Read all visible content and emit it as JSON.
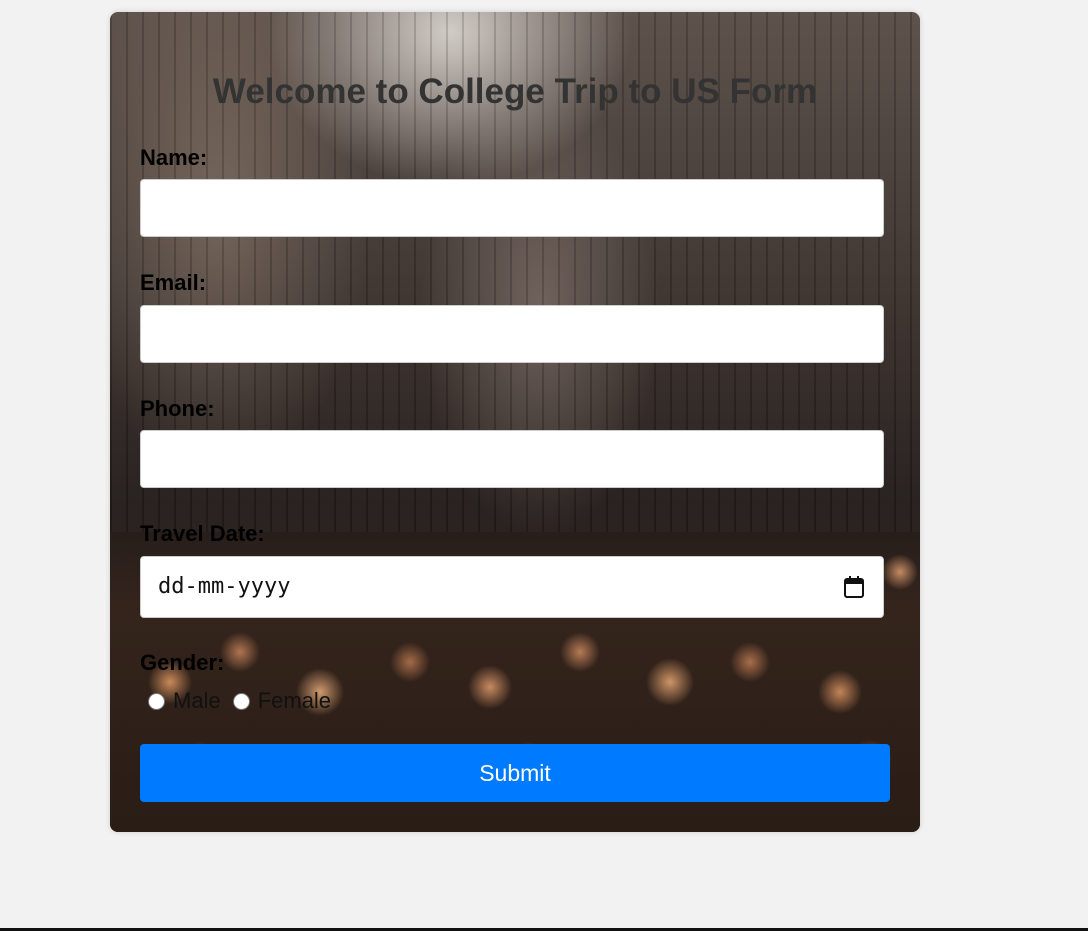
{
  "form": {
    "title": "Welcome to College Trip to US Form",
    "name_label": "Name:",
    "name_value": "",
    "email_label": "Email:",
    "email_value": "",
    "phone_label": "Phone:",
    "phone_value": "",
    "travel_date_label": "Travel Date:",
    "travel_date_placeholder": "dd-mm-yyyy",
    "gender_label": "Gender:",
    "gender_options": [
      "Male",
      "Female"
    ],
    "submit_label": "Submit"
  },
  "colors": {
    "submit_button": "#007bff",
    "page_background": "#f2f2f2",
    "title_text": "#333333"
  },
  "icons": {
    "date_picker": "calendar-icon"
  }
}
